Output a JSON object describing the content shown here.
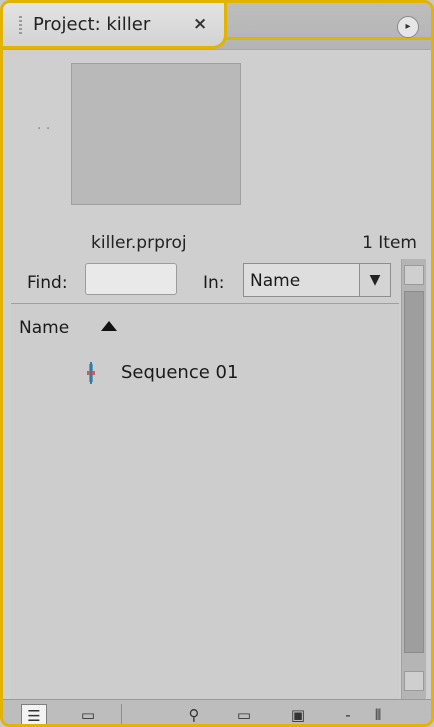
{
  "panel": {
    "tab_title": "Project: killer",
    "close_glyph": "×",
    "menu_glyph": "▸"
  },
  "preview": {
    "dots": "· ·",
    "project_file": "killer.prproj",
    "item_count": "1 Item"
  },
  "find": {
    "label": "Find:",
    "value": "",
    "in_label": "In:",
    "in_value": "Name",
    "dropdown_glyph": "▼"
  },
  "list": {
    "column_header": "Name",
    "items": [
      {
        "label": "Sequence 01",
        "icon": "sequence-icon"
      }
    ]
  },
  "toolbar": {
    "buttons": [
      {
        "name": "list-view-button",
        "glyph": "☰",
        "icon": "list-view-icon"
      },
      {
        "name": "icon-view-button",
        "glyph": "▭",
        "icon": "icon-view-icon"
      },
      {
        "name": "automate-to-sequence-button",
        "glyph": "⚲",
        "icon": "binoculars-icon"
      },
      {
        "name": "new-bin-button",
        "glyph": "▭",
        "icon": "folder-icon"
      },
      {
        "name": "new-item-button",
        "glyph": "▣",
        "icon": "new-item-icon"
      },
      {
        "name": "clear-button",
        "glyph": "-",
        "icon": "delete-icon"
      },
      {
        "name": "toggle-button",
        "glyph": "⦀",
        "icon": "toggle-icon"
      }
    ]
  },
  "colors": {
    "accent": "#e2b300",
    "panel_bg": "#cfcfcf"
  }
}
